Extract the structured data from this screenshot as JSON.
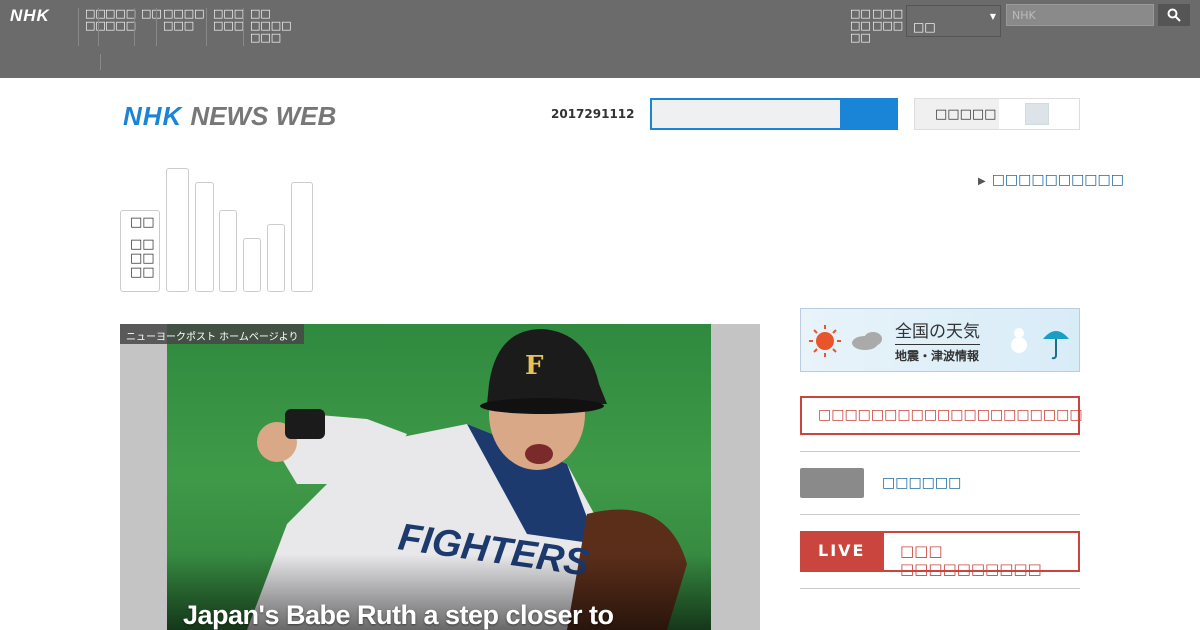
{
  "topbar": {
    "logo": "NHK",
    "nav": [
      {
        "label": "□□\n□□"
      },
      {
        "label": "□□□\n□□□"
      },
      {
        "label": "□□"
      },
      {
        "label": "□□□□\n□□□"
      },
      {
        "label": "□□□\n□□□"
      },
      {
        "label": "□□\n□□□□\n□□□"
      }
    ],
    "right_nav": [
      {
        "label": "□□\n□□\n□□"
      },
      {
        "label": "□□□\n□□□"
      }
    ],
    "region_value": "□□",
    "search_placeholder": "NHK",
    "search_icon": "search-icon"
  },
  "header": {
    "brand_nhk": "NHK",
    "brand_news": "NEWS WEB",
    "date_code": "2017291112",
    "toggle_label": "□□□□□"
  },
  "categories": {
    "first_label_top": "□□",
    "first_label_bottom": "□□\n□□\n□□",
    "bars": [
      124,
      110,
      82,
      54,
      68,
      110
    ]
  },
  "right_link": "□□□□□□□□□□",
  "hero": {
    "credit": "ニューヨークポスト ホームページより",
    "title": "Japan's Babe Ruth a step closer to"
  },
  "sidebar": {
    "weather_title": "全国の天気",
    "weather_sub": "地震・津波情報",
    "notice": "□□□□□□□□□□□□□□□□□□□□",
    "link2": "□□□□□□",
    "live_tag": "LIVE",
    "live_text": "□□□ □□□□□□□□□□"
  },
  "colors": {
    "accent": "#1a85d6",
    "alert": "#c9453d",
    "topbar": "#6b6b6b"
  }
}
